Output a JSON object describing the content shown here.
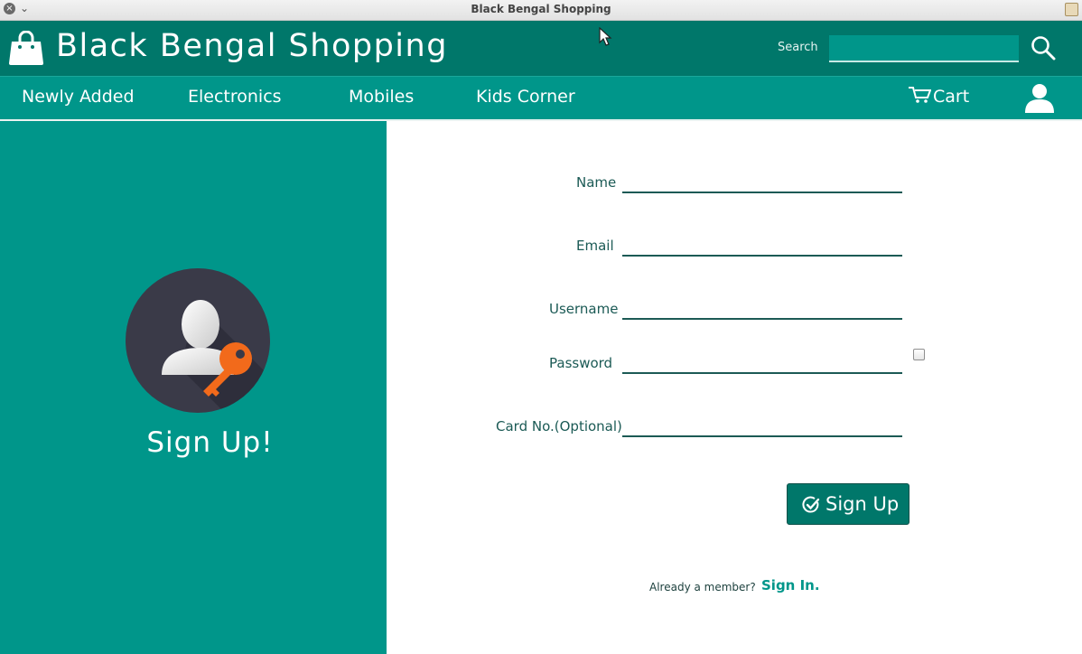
{
  "window": {
    "title": "Black Bengal Shopping",
    "close_glyph": "×",
    "menu_glyph": "⌄"
  },
  "header": {
    "brand": "Black Bengal Shopping",
    "brand_icon": "shopping-bag-icon",
    "search_label": "Search",
    "search_value": "",
    "search_icon": "magnifier-icon"
  },
  "nav": {
    "items": [
      "Newly Added",
      "Electronics",
      "Mobiles",
      "Kids Corner"
    ],
    "cart_label": "Cart",
    "cart_icon": "cart-icon",
    "user_icon": "user-icon"
  },
  "left_panel": {
    "heading": "Sign Up!",
    "avatar_icon": "user-key-icon"
  },
  "form": {
    "name_label": "Name",
    "email_label": "Email",
    "username_label": "Username",
    "password_label": "Password",
    "card_label": "Card No.(Optional)",
    "name_value": "",
    "email_value": "",
    "username_value": "",
    "password_value": "",
    "card_value": "",
    "show_password_checked": false,
    "submit_label": "Sign Up",
    "submit_icon": "check-circle-icon"
  },
  "footer": {
    "member_text": "Already a member?",
    "signin_label": "Sign In."
  },
  "colors": {
    "header": "#00776a",
    "nav": "#00968a",
    "panel": "#00968a",
    "label": "#1b5a55",
    "accent_orange": "#f26a1b",
    "avatar_bg": "#3a3a48"
  }
}
